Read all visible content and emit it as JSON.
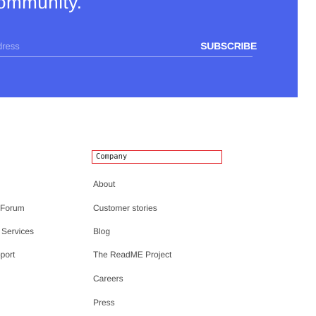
{
  "banner": {
    "heading": "ommunity.",
    "email_placeholder": "dress",
    "subscribe_label": "SUBSCRIBE"
  },
  "footer": {
    "left_column": {
      "items": [
        {
          "label": "Forum"
        },
        {
          "label": "Services"
        },
        {
          "label": "pport"
        }
      ]
    },
    "company_column": {
      "heading": "Company",
      "items": [
        {
          "label": "About"
        },
        {
          "label": "Customer stories"
        },
        {
          "label": "Blog"
        },
        {
          "label": "The ReadME Project"
        },
        {
          "label": "Careers"
        },
        {
          "label": "Press"
        }
      ]
    }
  },
  "colors": {
    "banner_background": "#4a63ec",
    "link_text": "#4a4a4a",
    "focus_outline": "#e0171d"
  }
}
